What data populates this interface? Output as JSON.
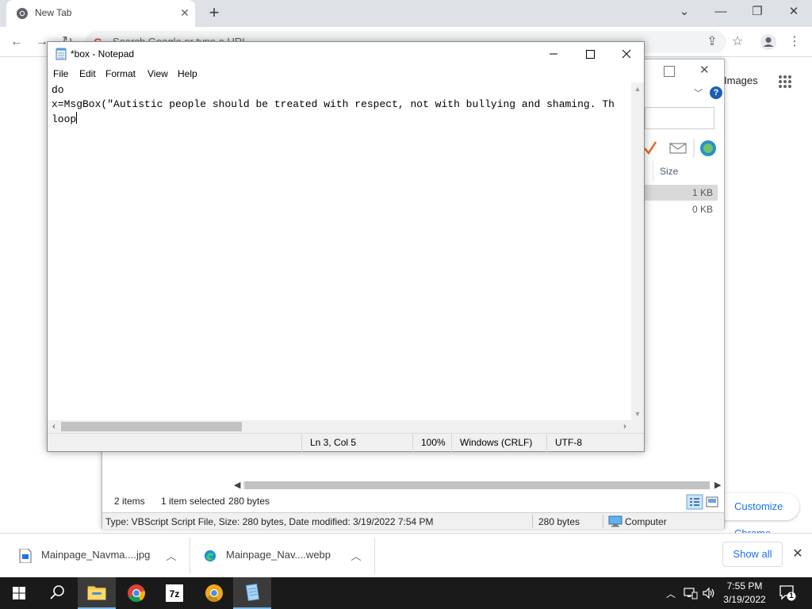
{
  "chrome": {
    "tab_title": "New Tab",
    "omnibox_placeholder": "Search Google or type a URL",
    "ntp_images_link": "Images",
    "customize_label": "Customize Chrome"
  },
  "downloads": {
    "items": [
      {
        "name": "Mainpage_Navma....jpg",
        "icon": "image-file-icon"
      },
      {
        "name": "Mainpage_Nav....webp",
        "icon": "edge-icon"
      }
    ],
    "show_all_label": "Show all"
  },
  "explorer": {
    "size_header": "Size",
    "sizes": [
      "1 KB",
      "0 KB"
    ],
    "status": {
      "items": "2 items",
      "selected": "1 item selected",
      "bytes": "280 bytes"
    },
    "details": {
      "text": "Type: VBScript Script File, Size: 280 bytes, Date modified: 3/19/2022 7:54 PM",
      "size": "280 bytes",
      "location": "Computer"
    }
  },
  "notepad": {
    "title": "*box - Notepad",
    "menu": [
      "File",
      "Edit",
      "Format",
      "View",
      "Help"
    ],
    "lines": [
      "do",
      "x=MsgBox(\"Autistic people should be treated with respect, not with bullying and shaming. Th",
      "loop"
    ],
    "status": {
      "position": "Ln 3, Col 5",
      "zoom": "100%",
      "line_ending": "Windows (CRLF)",
      "encoding": "UTF-8"
    }
  },
  "taskbar": {
    "apps": [
      "windows-start-icon",
      "search-icon",
      "file-explorer-icon",
      "chrome-icon",
      "7zip-icon",
      "chrome-canary-icon",
      "notepad-icon"
    ],
    "time": "7:55 PM",
    "date": "3/19/2022",
    "notification_count": "1"
  }
}
